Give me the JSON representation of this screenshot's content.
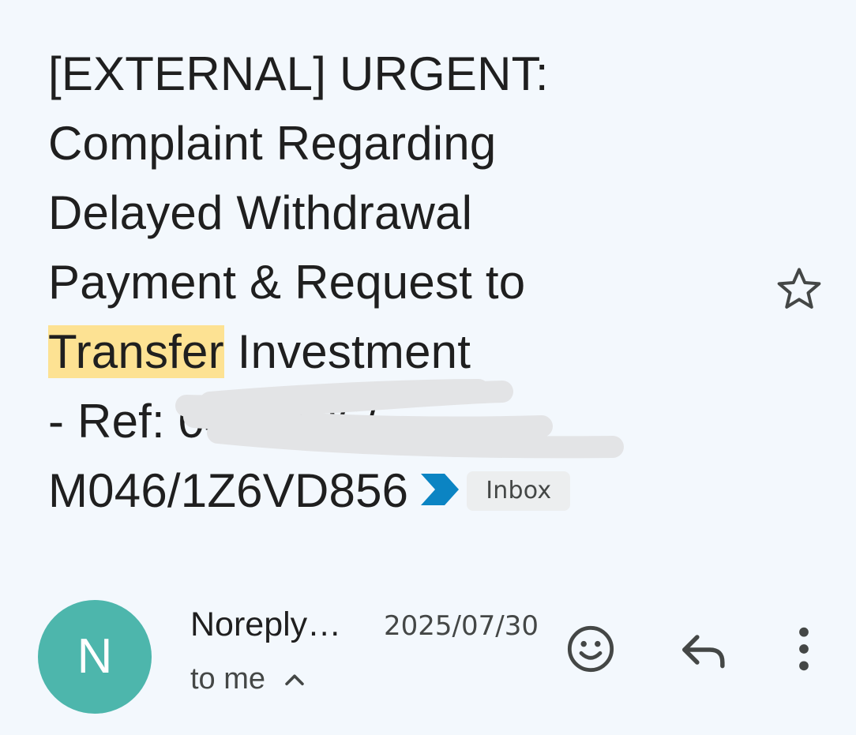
{
  "subject": {
    "line1": "[EXTERNAL] URGENT:",
    "line2": "Complaint Regarding",
    "line3": "Delayed Withdrawal",
    "line4": "Payment & Request to",
    "line5_highlight": "Transfer",
    "line5_rest": " Investment",
    "line6_prefix": "- Ref: ",
    "line6_redacted": "0459496",
    "line6_suffix": "/",
    "line7": "M046/1Z6VD856",
    "label": "Inbox",
    "highlight_color": "#fde293",
    "important_marker_color": "#0b84c3"
  },
  "actions": {
    "star_icon": "star-outline-icon",
    "emoji_icon": "emoji-reaction-icon",
    "reply_icon": "reply-icon",
    "more_icon": "more-vertical-icon"
  },
  "sender": {
    "avatar_letter": "N",
    "avatar_color": "#4db6ac",
    "name": "Noreply…",
    "date": "2025/07/30",
    "recipient": "to me"
  }
}
